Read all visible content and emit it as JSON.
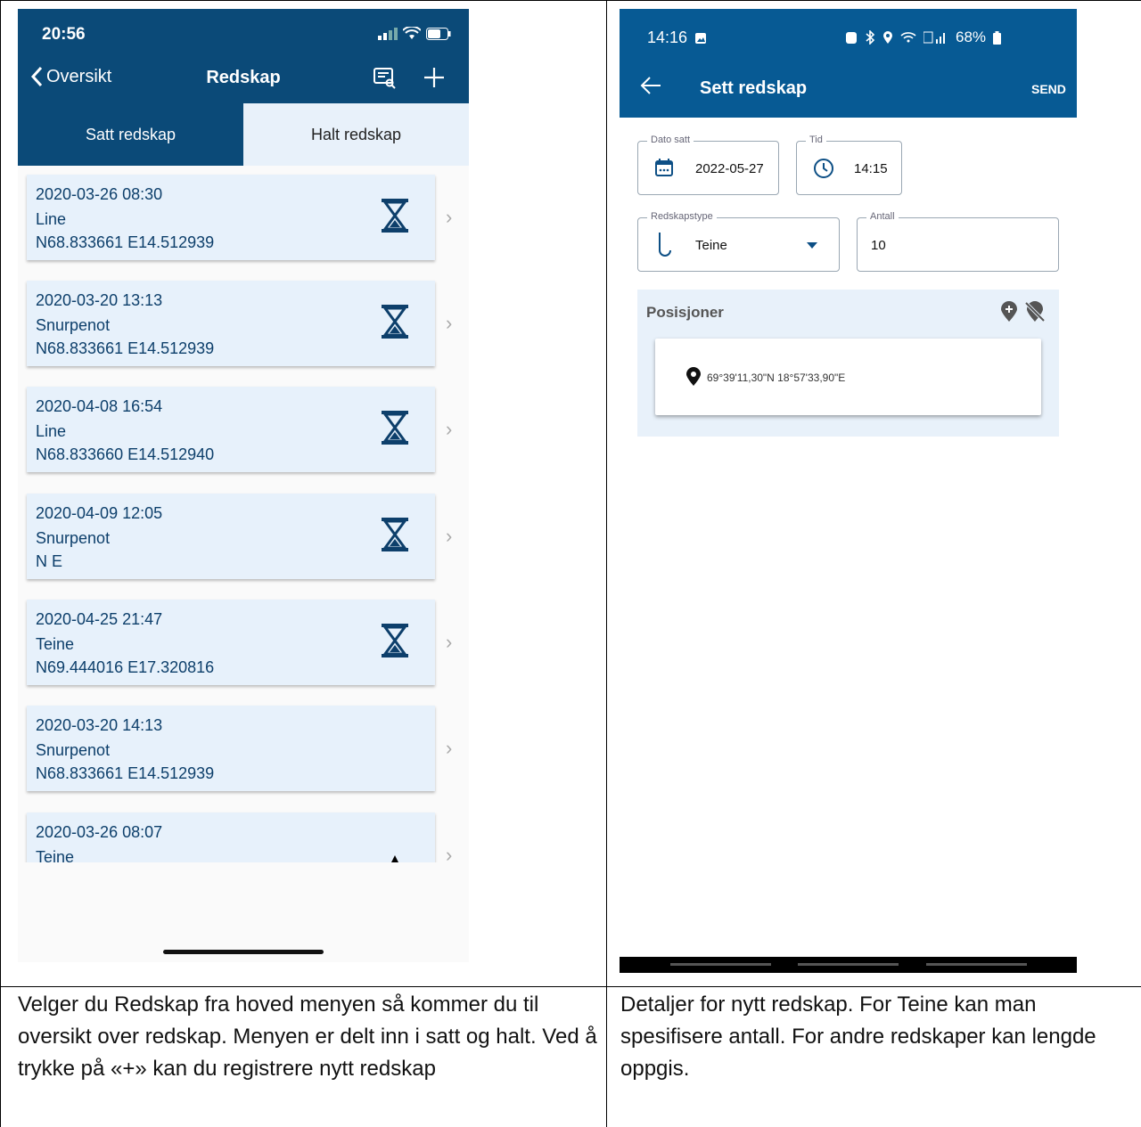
{
  "left_phone": {
    "time": "20:56",
    "nav": {
      "back_label": "Oversikt",
      "title": "Redskap"
    },
    "tabs": [
      {
        "label": "Satt redskap"
      },
      {
        "label": "Halt redskap"
      }
    ],
    "entries": [
      {
        "datetime": "2020-03-26  08:30",
        "type": "Line",
        "coords": "N68.833661  E14.512939",
        "status": "hourglass-icon"
      },
      {
        "datetime": "2020-03-20  13:13",
        "type": "Snurpenot",
        "coords": "N68.833661  E14.512939",
        "status": "hourglass-icon"
      },
      {
        "datetime": "2020-04-08  16:54",
        "type": "Line",
        "coords": "N68.833660  E14.512940",
        "status": "hourglass-icon"
      },
      {
        "datetime": "2020-04-09  12:05",
        "type": "Snurpenot",
        "coords": "N  E",
        "status": "hourglass-icon"
      },
      {
        "datetime": "2020-04-25  21:47",
        "type": "Teine",
        "coords": "N69.444016  E17.320816",
        "status": "hourglass-icon"
      },
      {
        "datetime": "2020-03-20  14:13",
        "type": "Snurpenot",
        "coords": "N68.833661  E14.512939",
        "status": "none"
      },
      {
        "datetime": "2020-03-26  08:07",
        "type": "Teine",
        "coords": "",
        "status": "warning-icon"
      }
    ]
  },
  "right_phone": {
    "time": "14:16",
    "battery": "68%",
    "nav": {
      "title": "Sett redskap",
      "send_label": "SEND"
    },
    "date_field": {
      "label": "Dato satt",
      "value": "2022-05-27"
    },
    "time_field": {
      "label": "Tid",
      "value": "14:15"
    },
    "type_field": {
      "label": "Redskapstype",
      "value": "Teine"
    },
    "count_field": {
      "label": "Antall",
      "value": "10"
    },
    "positions": {
      "title": "Posisjoner",
      "items": [
        "69°39'11,30\"N 18°57'33,90\"E"
      ]
    }
  },
  "captions": {
    "left": "Velger du Redskap fra hoved menyen så kommer du til oversikt over redskap. Menyen er delt inn i satt og halt. Ved å trykke på «+» kan du registrere nytt redskap",
    "right": "Detaljer for nytt redskap. For Teine kan man spesifisere antall. For andre redskaper kan lengde oppgis."
  },
  "colors": {
    "ios_header": "#0b4a78",
    "android_header": "#075a94",
    "card_bg": "#e7f1fb"
  }
}
